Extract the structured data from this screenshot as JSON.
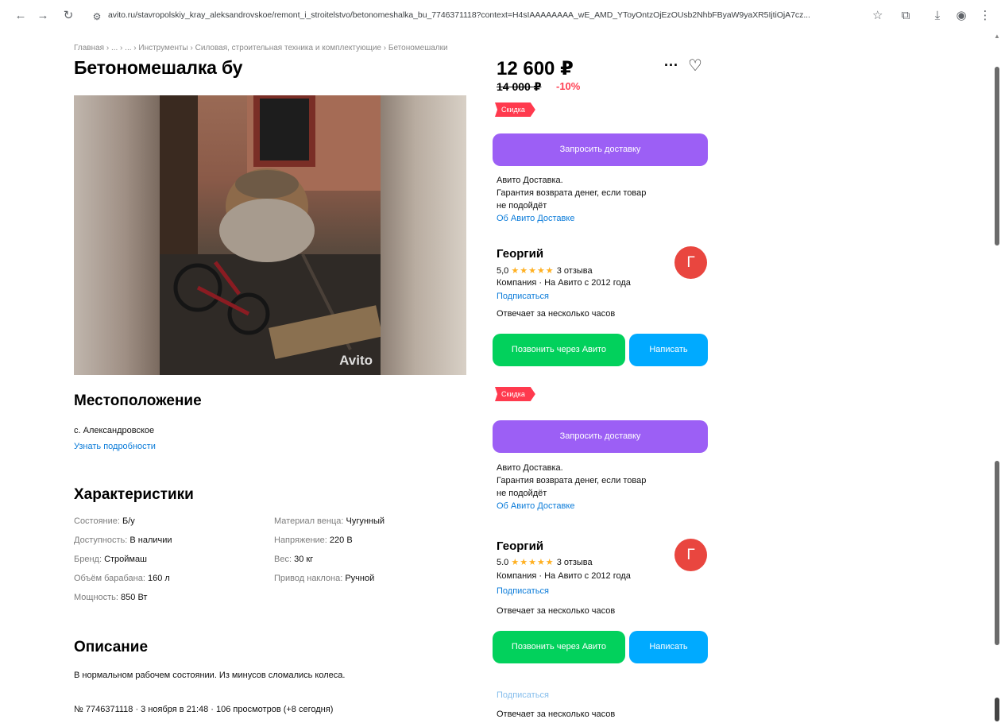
{
  "browser": {
    "url": "avito.ru/stavropolskiy_kray_aleksandrovskoe/remont_i_stroitelstvo/betonomeshalka_bu_7746371118?context=H4sIAAAAAAAA_wE_AMD_YToyOntzOjEzOUsb2NhbFByaW9yaXR5IjtiOjA7cz..."
  },
  "breadcrumb": "Главная › ... › ... › Инструменты › Силовая, строительная техника и комплектующие › Бетономешалки",
  "listing": {
    "title": "Бетономешалка бу",
    "photo_watermark": "Avito",
    "price": "12 600 ₽",
    "old_price": "14 000 ₽",
    "discount": "-10%",
    "sale_badge": "Скидка"
  },
  "location": {
    "heading": "Местоположение",
    "place": "с. Александровское",
    "details_link": "Узнать подробности"
  },
  "specs": {
    "heading": "Характеристики",
    "left": [
      {
        "k": "Состояние: ",
        "v": "Б/у"
      },
      {
        "k": "Доступность: ",
        "v": "В наличии"
      },
      {
        "k": "Бренд: ",
        "v": "Строймаш"
      },
      {
        "k": "Объём барабана: ",
        "v": "160 л"
      },
      {
        "k": "Мощность: ",
        "v": "850 Вт"
      }
    ],
    "right": [
      {
        "k": "Материал венца: ",
        "v": "Чугунный"
      },
      {
        "k": "Напряжение: ",
        "v": "220 В"
      },
      {
        "k": "Вес: ",
        "v": "30 кг"
      },
      {
        "k": "Привод наклона: ",
        "v": "Ручной"
      }
    ]
  },
  "description": {
    "heading": "Описание",
    "text": "В нормальном рабочем состоянии. Из минусов сломались колеса."
  },
  "footer_meta": "№ 7746371118 · 3 ноября в 21:48 · 106 просмотров (+8 сегодня)",
  "delivery": {
    "button": "Запросить доставку",
    "line1": "Авито Доставка.",
    "line2": "Гарантия возврата денег, если товар",
    "line3": "не подойдёт",
    "link": "Об Авито Доставке"
  },
  "seller": {
    "name": "Георгий",
    "rating": "5,0",
    "rating_alt": "5.0",
    "stars": "★★★★★",
    "reviews": "3 отзыва",
    "company": "Компания · На Авито с 2012 года",
    "subscribe": "Подписаться",
    "responds": "Отвечает за несколько часов",
    "avatar_letter": "Г",
    "call_button": "Позвонить через Авито",
    "write_button": "Написать"
  },
  "menu_dots": "···",
  "heart_icon": "♡",
  "colors": {
    "purple": "#9c5ff5",
    "green": "#02d15c",
    "blue": "#00aaff",
    "sale": "#ff3a4e",
    "link": "#0a7bd9"
  }
}
